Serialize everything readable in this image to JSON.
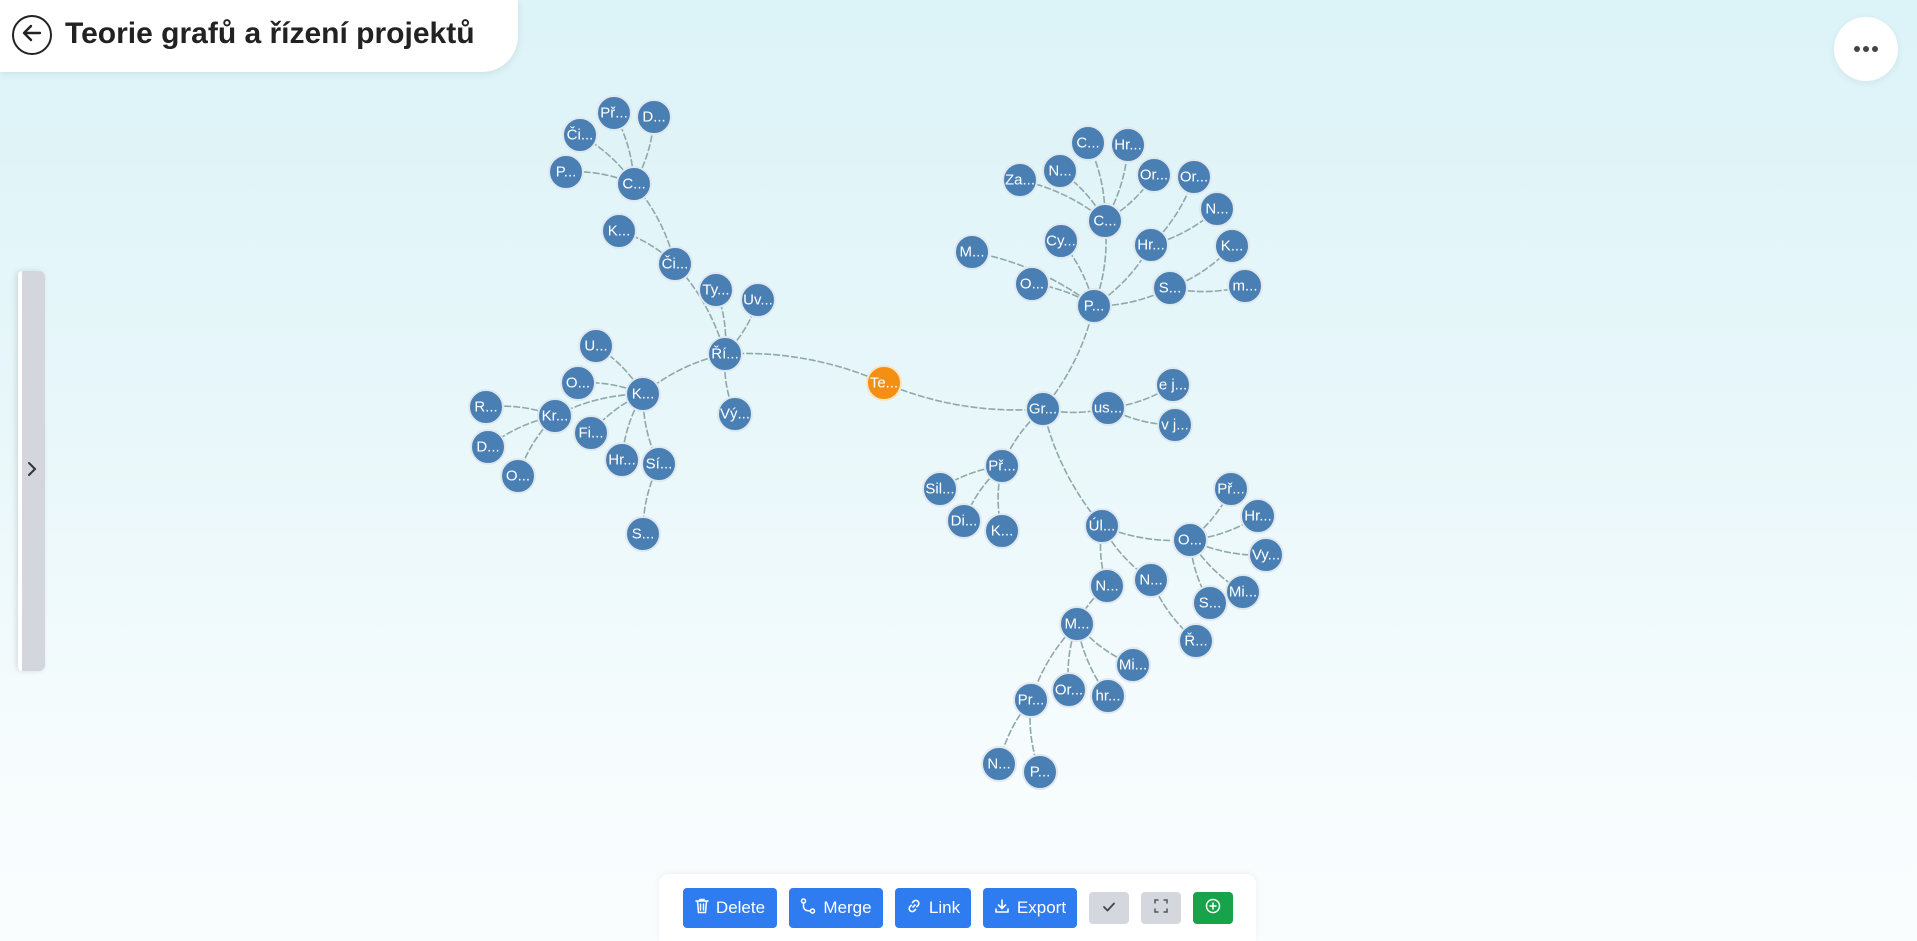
{
  "header": {
    "title": "Teorie grafů a řízení projektů"
  },
  "toolbar": {
    "delete_label": "Delete",
    "merge_label": "Merge",
    "link_label": "Link",
    "export_label": "Export"
  },
  "icons": {
    "back": "arrow-left-icon",
    "more": "ellipsis-icon",
    "sidebar_toggle": "chevron-right-icon",
    "delete": "trash-icon",
    "merge": "merge-icon",
    "link": "link-icon",
    "export": "download-icon",
    "confirm": "check-icon",
    "fullscreen": "fullscreen-icon",
    "add": "plus-circle-icon"
  },
  "colors": {
    "node": "#4a7fb3",
    "root_node": "#f39014",
    "primary_button": "#2f7bf0",
    "add_button": "#16a34a",
    "neutral_button": "#d4d7dd"
  },
  "graph": {
    "root": "Te...",
    "nodes": [
      {
        "id": "te",
        "label": "Te...",
        "root": true
      },
      {
        "id": "ri",
        "label": "Ří..."
      },
      {
        "id": "gr",
        "label": "Gr..."
      },
      {
        "id": "ty",
        "label": "Ty..."
      },
      {
        "id": "uv",
        "label": "Uv..."
      },
      {
        "id": "vy1",
        "label": "Vý..."
      },
      {
        "id": "k1",
        "label": "K..."
      },
      {
        "id": "ci1",
        "label": "Či..."
      },
      {
        "id": "k2",
        "label": "K..."
      },
      {
        "id": "c1",
        "label": "C..."
      },
      {
        "id": "pr1",
        "label": "Př..."
      },
      {
        "id": "d1",
        "label": "D..."
      },
      {
        "id": "ci2",
        "label": "Či..."
      },
      {
        "id": "p1",
        "label": "P..."
      },
      {
        "id": "u1",
        "label": "U..."
      },
      {
        "id": "o1",
        "label": "O..."
      },
      {
        "id": "kr",
        "label": "Kr..."
      },
      {
        "id": "fi",
        "label": "Fi..."
      },
      {
        "id": "hr1",
        "label": "Hr..."
      },
      {
        "id": "si",
        "label": "Sí..."
      },
      {
        "id": "r1",
        "label": "R..."
      },
      {
        "id": "d2",
        "label": "D..."
      },
      {
        "id": "o2",
        "label": "O..."
      },
      {
        "id": "s1",
        "label": "S..."
      },
      {
        "id": "p2",
        "label": "P..."
      },
      {
        "id": "m1",
        "label": "M..."
      },
      {
        "id": "o3",
        "label": "O..."
      },
      {
        "id": "cy",
        "label": "Cy..."
      },
      {
        "id": "c2",
        "label": "C..."
      },
      {
        "id": "hr2",
        "label": "Hr..."
      },
      {
        "id": "s2",
        "label": "S..."
      },
      {
        "id": "za",
        "label": "Za..."
      },
      {
        "id": "n1",
        "label": "N..."
      },
      {
        "id": "c3",
        "label": "C..."
      },
      {
        "id": "hr3",
        "label": "Hr..."
      },
      {
        "id": "or1",
        "label": "Or..."
      },
      {
        "id": "or2",
        "label": "Or..."
      },
      {
        "id": "n2",
        "label": "N..."
      },
      {
        "id": "k3",
        "label": "K..."
      },
      {
        "id": "m2",
        "label": "m..."
      },
      {
        "id": "us",
        "label": "us..."
      },
      {
        "id": "ej",
        "label": "e j..."
      },
      {
        "id": "vj",
        "label": "v j..."
      },
      {
        "id": "pr2",
        "label": "Př..."
      },
      {
        "id": "sil",
        "label": "Sil..."
      },
      {
        "id": "di",
        "label": "Di..."
      },
      {
        "id": "k4",
        "label": "K..."
      },
      {
        "id": "ul",
        "label": "Úl..."
      },
      {
        "id": "o4",
        "label": "O..."
      },
      {
        "id": "pr3",
        "label": "Př..."
      },
      {
        "id": "hr4",
        "label": "Hr..."
      },
      {
        "id": "vy2",
        "label": "Vy..."
      },
      {
        "id": "mi1",
        "label": "Mi..."
      },
      {
        "id": "s3",
        "label": "S..."
      },
      {
        "id": "r2",
        "label": "Ř..."
      },
      {
        "id": "n3",
        "label": "N..."
      },
      {
        "id": "n4",
        "label": "N..."
      },
      {
        "id": "m3",
        "label": "M..."
      },
      {
        "id": "mi2",
        "label": "Mi..."
      },
      {
        "id": "hr5",
        "label": "hr..."
      },
      {
        "id": "or3",
        "label": "Or..."
      },
      {
        "id": "pr4",
        "label": "Pr..."
      },
      {
        "id": "n5",
        "label": "N..."
      },
      {
        "id": "p3",
        "label": "P..."
      }
    ],
    "edges": [
      [
        "te",
        "ri"
      ],
      [
        "te",
        "gr"
      ],
      [
        "ri",
        "ty"
      ],
      [
        "ri",
        "uv"
      ],
      [
        "ri",
        "vy1"
      ],
      [
        "ri",
        "k1"
      ],
      [
        "ri",
        "ci1"
      ],
      [
        "ci1",
        "k2"
      ],
      [
        "ci1",
        "c1"
      ],
      [
        "c1",
        "pr1"
      ],
      [
        "c1",
        "d1"
      ],
      [
        "c1",
        "ci2"
      ],
      [
        "c1",
        "p1"
      ],
      [
        "k1",
        "u1"
      ],
      [
        "k1",
        "o1"
      ],
      [
        "k1",
        "kr"
      ],
      [
        "k1",
        "fi"
      ],
      [
        "k1",
        "hr1"
      ],
      [
        "k1",
        "si"
      ],
      [
        "kr",
        "r1"
      ],
      [
        "kr",
        "d2"
      ],
      [
        "kr",
        "o2"
      ],
      [
        "si",
        "s1"
      ],
      [
        "gr",
        "p2"
      ],
      [
        "gr",
        "us"
      ],
      [
        "gr",
        "pr2"
      ],
      [
        "gr",
        "ul"
      ],
      [
        "p2",
        "m1"
      ],
      [
        "p2",
        "o3"
      ],
      [
        "p2",
        "cy"
      ],
      [
        "p2",
        "c2"
      ],
      [
        "p2",
        "hr2"
      ],
      [
        "p2",
        "s2"
      ],
      [
        "c2",
        "za"
      ],
      [
        "c2",
        "n1"
      ],
      [
        "c2",
        "c3"
      ],
      [
        "c2",
        "hr3"
      ],
      [
        "c2",
        "or1"
      ],
      [
        "hr2",
        "or2"
      ],
      [
        "hr2",
        "n2"
      ],
      [
        "s2",
        "k3"
      ],
      [
        "s2",
        "m2"
      ],
      [
        "us",
        "ej"
      ],
      [
        "us",
        "vj"
      ],
      [
        "pr2",
        "sil"
      ],
      [
        "pr2",
        "di"
      ],
      [
        "pr2",
        "k4"
      ],
      [
        "ul",
        "o4"
      ],
      [
        "ul",
        "n3"
      ],
      [
        "ul",
        "n4"
      ],
      [
        "o4",
        "pr3"
      ],
      [
        "o4",
        "hr4"
      ],
      [
        "o4",
        "vy2"
      ],
      [
        "o4",
        "mi1"
      ],
      [
        "o4",
        "s3"
      ],
      [
        "n4",
        "r2"
      ],
      [
        "n3",
        "m3"
      ],
      [
        "m3",
        "mi2"
      ],
      [
        "m3",
        "hr5"
      ],
      [
        "m3",
        "or3"
      ],
      [
        "m3",
        "pr4"
      ],
      [
        "pr4",
        "n5"
      ],
      [
        "pr4",
        "p3"
      ]
    ]
  }
}
